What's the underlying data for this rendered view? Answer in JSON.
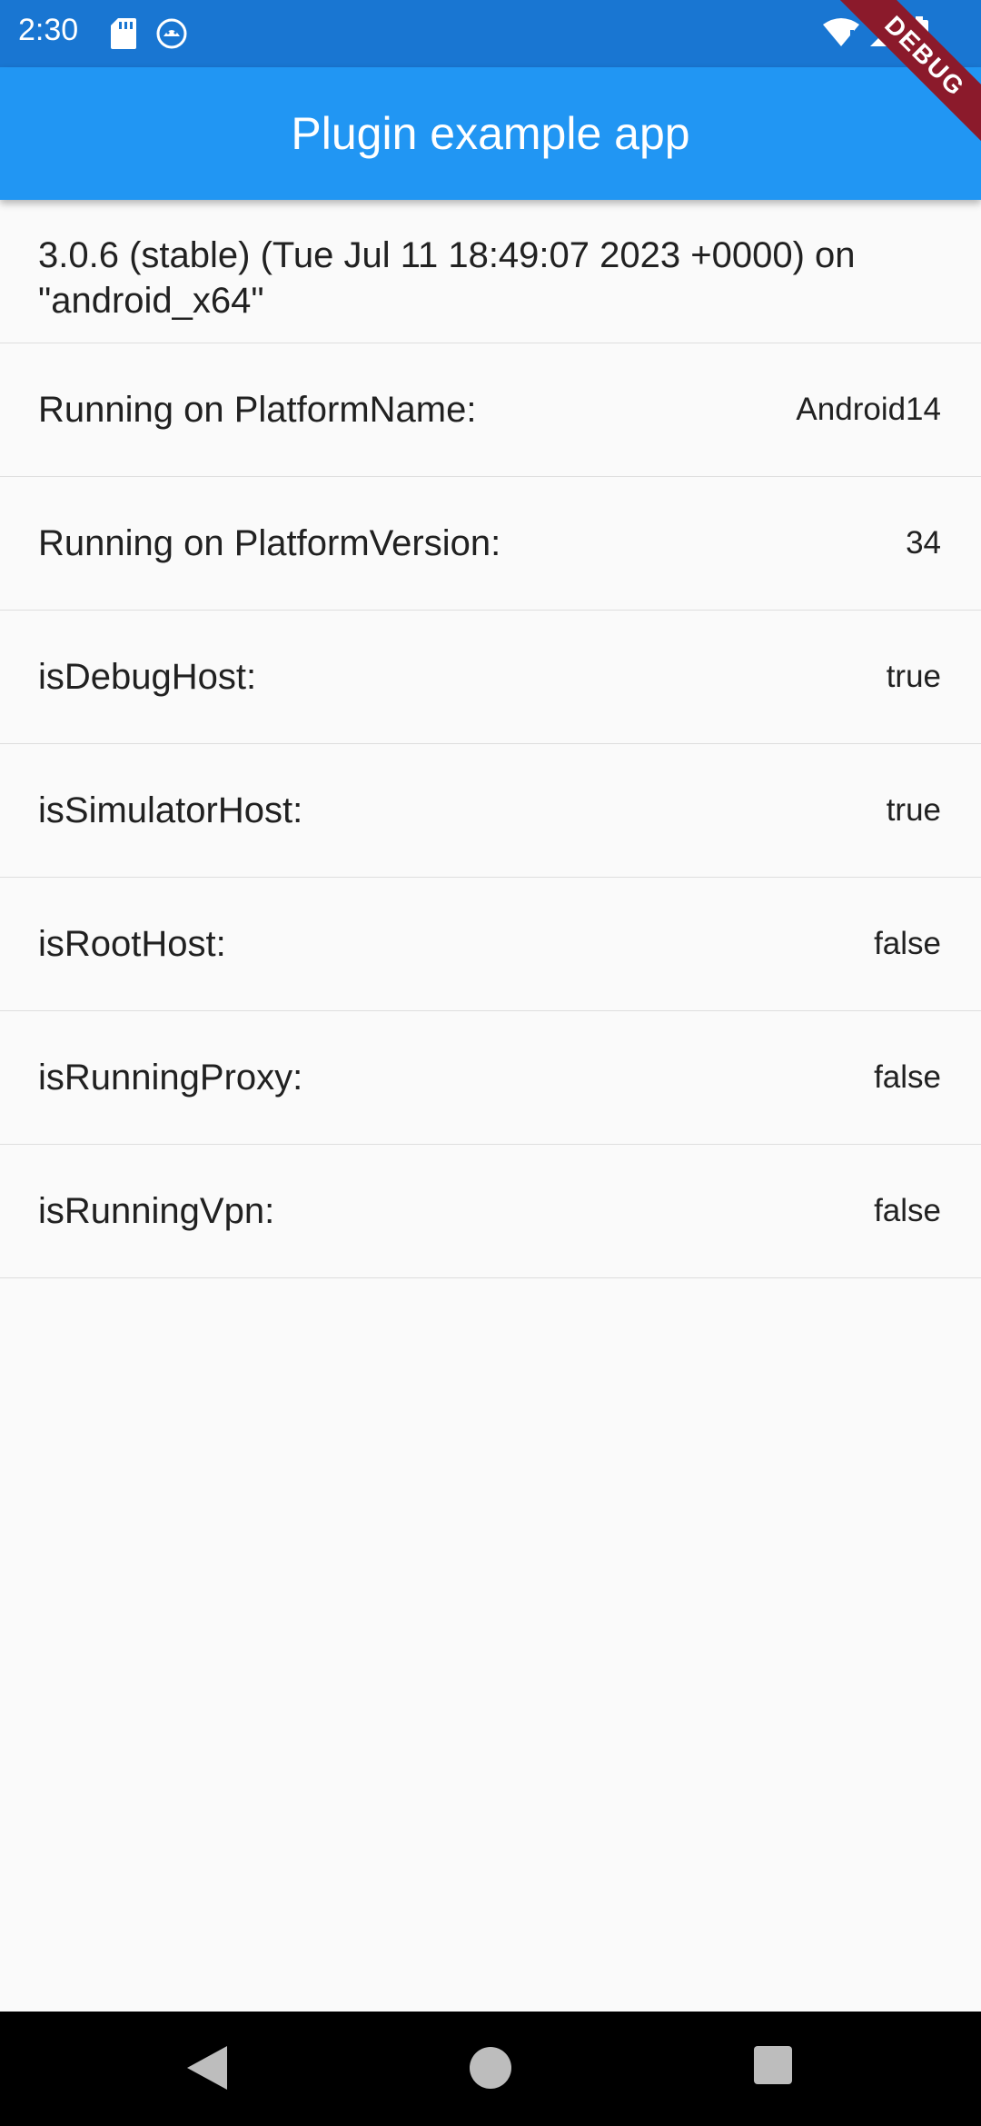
{
  "status_bar": {
    "time": "2:30",
    "left_icons": [
      "sd-card-icon",
      "android-debug-icon"
    ],
    "right_icons": [
      "wifi-icon",
      "signal-icon",
      "battery-icon"
    ]
  },
  "app_bar": {
    "title": "Plugin example app",
    "debug_banner": "DEBUG",
    "background": "#2196f3"
  },
  "version_text": "3.0.6 (stable) (Tue Jul 11 18:49:07 2023 +0000) on \"android_x64\"",
  "rows": [
    {
      "label": "Running on PlatformName:",
      "value": "Android14"
    },
    {
      "label": "Running on PlatformVersion:",
      "value": "34"
    },
    {
      "label": "isDebugHost:",
      "value": "true"
    },
    {
      "label": "isSimulatorHost:",
      "value": "true"
    },
    {
      "label": "isRootHost:",
      "value": "false"
    },
    {
      "label": "isRunningProxy:",
      "value": "false"
    },
    {
      "label": "isRunningVpn:",
      "value": "false"
    }
  ],
  "nav_bar": {
    "buttons": [
      "back-icon",
      "home-icon",
      "recents-icon"
    ]
  }
}
